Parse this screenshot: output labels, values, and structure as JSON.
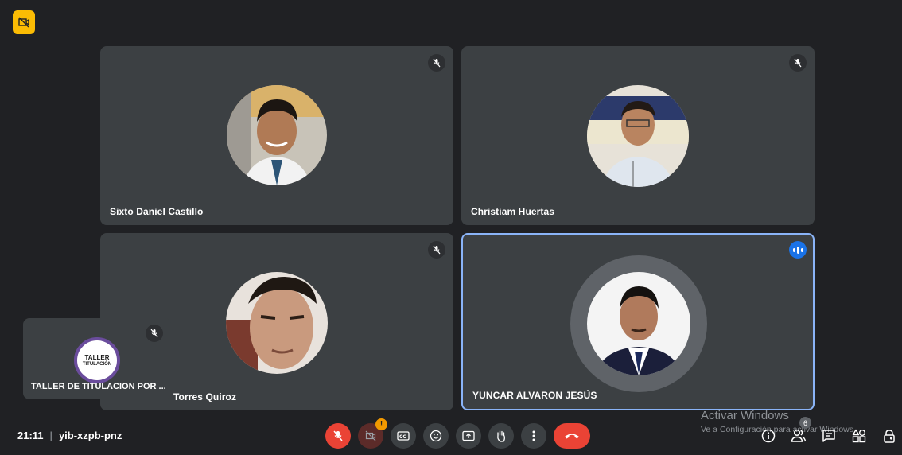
{
  "meeting": {
    "time": "21:11",
    "separator": "|",
    "code": "yib-xzpb-pnz"
  },
  "participants": [
    {
      "name": "Sixto Daniel Castillo",
      "mic": "muted"
    },
    {
      "name": "Christiam Huertas",
      "mic": "muted"
    },
    {
      "name": "Torres Quiroz",
      "mic": "muted"
    },
    {
      "name": "YUNCAR ALVARON JESÚS",
      "mic": "speaking"
    }
  ],
  "self_view": {
    "name": "TALLER DE TITULACION POR ...",
    "logo_text_line1": "TALLER",
    "logo_text_line2": "TITULACIÓN"
  },
  "controls": {
    "mic": "microphone-off",
    "camera": "camera-off",
    "camera_alert": "!",
    "captions": "captions",
    "reactions": "emoji",
    "present": "present-screen",
    "raise_hand": "hand",
    "more": "more-options",
    "leave": "end-call"
  },
  "right_panel": {
    "people_count": "6"
  },
  "watermark": {
    "title": "Activar Windows",
    "subtitle": "Ve a Configuración para activar Windows."
  },
  "colors": {
    "background": "#202124",
    "tile": "#3c4043",
    "accent_red": "#ea4335",
    "speaking_blue": "#1a73e8",
    "active_border": "#8ab4f8",
    "warning": "#fbbc04"
  }
}
